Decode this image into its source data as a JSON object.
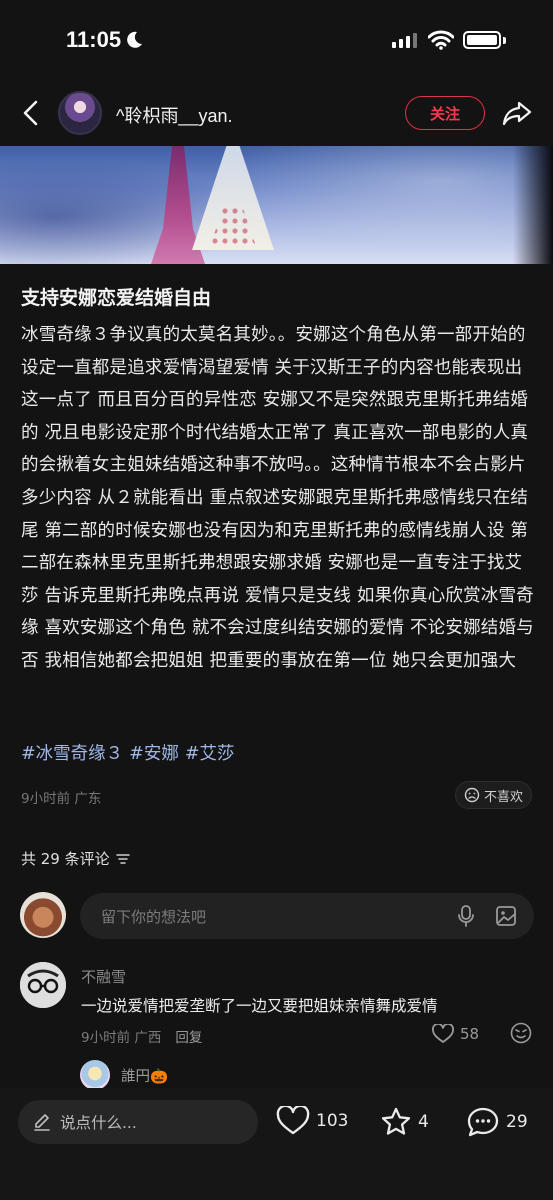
{
  "status_bar": {
    "time": "11:05"
  },
  "nav": {
    "username": "^聆枳雨__yan.",
    "follow_label": "关注"
  },
  "post": {
    "title": "支持安娜恋爱结婚自由",
    "body": "冰雪奇缘３争议真的太莫名其妙。。安娜这个角色从第一部开始的设定一直都是追求爱情渴望爱情 关于汉斯王子的内容也能表现出这一点了 而且百分百的异性恋 安娜又不是突然跟克里斯托弗结婚的 况且电影设定那个时代结婚太正常了 真正喜欢一部电影的人真的会揪着女主姐妹结婚这种事不放吗。。这种情节根本不会占影片多少内容 从２就能看出 重点叙述安娜跟克里斯托弗感情线只在结尾 第二部的时候安娜也没有因为和克里斯托弗的感情线崩人设 第二部在森林里克里斯托弗想跟安娜求婚 安娜也是一直专注于找艾莎 告诉克里斯托弗晚点再说 爱情只是支线 如果你真心欣赏冰雪奇缘 喜欢安娜这个角色 就不会过度纠结安娜的爱情 不论安娜结婚与否 我相信她都会把姐姐 把重要的事放在第一位 她只会更加强大",
    "tags": [
      "#冰雪奇缘３",
      "#安娜",
      "#艾莎"
    ],
    "time": "9小时前",
    "location": "广东",
    "dislike_label": "不喜欢"
  },
  "comments": {
    "header": "共 29 条评论",
    "input_placeholder": "留下你的想法吧",
    "items": [
      {
        "name": "不融雪",
        "text": "一边说爱情把爱垄断了一边又要把姐妹亲情舞成爱情",
        "time": "9小时前",
        "location": "广西",
        "reply_label": "回复",
        "likes": "58"
      },
      {
        "name": "誰円🎃"
      }
    ]
  },
  "bottom": {
    "say_placeholder": "说点什么...",
    "likes": "103",
    "favorites": "4",
    "comments": "29"
  },
  "colors": {
    "accent": "#ff3b4f",
    "tag": "#9fb8e8",
    "background": "#131313"
  }
}
